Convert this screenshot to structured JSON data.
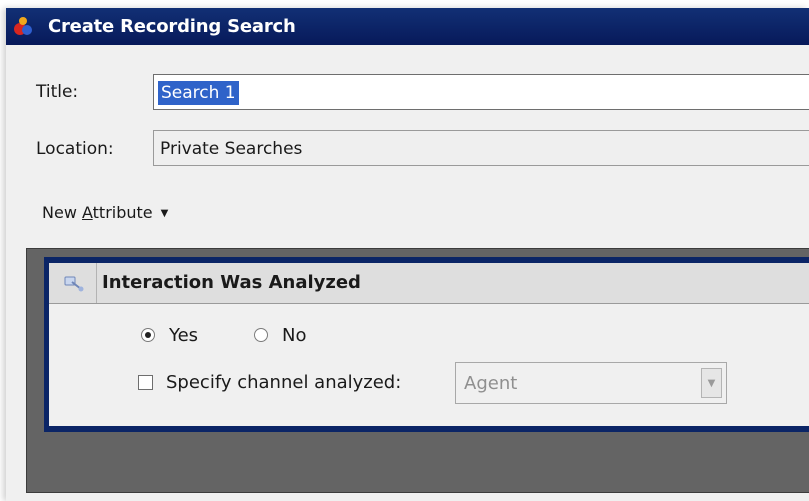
{
  "window": {
    "title": "Create Recording Search",
    "app_icon": "recording-app-icon"
  },
  "form": {
    "title_label": "Title:",
    "title_value": "Search 1",
    "location_label": "Location:",
    "location_value": "Private Searches"
  },
  "toolbar": {
    "new_attribute_prefix": "New ",
    "new_attribute_mnemonic": "A",
    "new_attribute_suffix": "ttribute",
    "dropdown_icon": "caret-down-icon"
  },
  "attribute_card": {
    "icon": "attribute-icon",
    "title": "Interaction Was Analyzed",
    "radio_yes_label": "Yes",
    "radio_no_label": "No",
    "selected": "Yes",
    "channel_checkbox_label": "Specify channel analyzed:",
    "channel_checkbox_checked": false,
    "channel_select_value": "Agent",
    "channel_select_enabled": false
  },
  "colors": {
    "titlebar": "#0b2566",
    "selection": "#2f63c9",
    "dialog_background": "#f0f0f0",
    "panel_background": "#646464"
  }
}
